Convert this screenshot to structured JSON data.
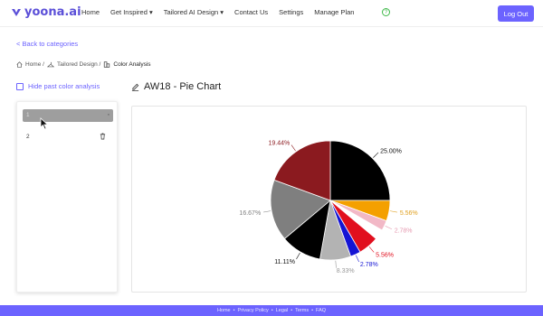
{
  "header": {
    "logo_text": "yoona.ai",
    "nav": [
      "Home",
      "Get Inspired ▾",
      "Tailored AI Design ▾",
      "Contact Us",
      "Settings",
      "Manage Plan"
    ],
    "logout_label": "Log Out",
    "accent_color": "#6c63ff"
  },
  "back_link": "< Back to categories",
  "breadcrumb": {
    "items": [
      "Home /",
      "Tailored Design /",
      "Color Analysis"
    ]
  },
  "hide_link": "Hide past color analysis",
  "page_title": "AW18 - Pie Chart",
  "sidebar": {
    "items": [
      {
        "label": "1",
        "selected": true
      },
      {
        "label": "2",
        "selected": false
      }
    ]
  },
  "chart_data": {
    "type": "pie",
    "slices": [
      {
        "label": "25.00%",
        "value": 25.0,
        "color": "#000000"
      },
      {
        "label": "5.56%",
        "value": 5.56,
        "color": "#f4a000"
      },
      {
        "label": "2.78%",
        "value": 2.78,
        "color": "#f2b8c6"
      },
      {
        "label": "",
        "value": 2.78,
        "color": "#ffffff"
      },
      {
        "label": "5.56%",
        "value": 5.56,
        "color": "#e10f1e"
      },
      {
        "label": "2.78%",
        "value": 2.78,
        "color": "#1414d4"
      },
      {
        "label": "8.33%",
        "value": 8.33,
        "color": "#b3b3b3"
      },
      {
        "label": "11.11%",
        "value": 11.11,
        "color": "#000000"
      },
      {
        "label": "16.67%",
        "value": 16.67,
        "color": "#7f7f7f"
      },
      {
        "label": "19.44%",
        "value": 19.44,
        "color": "#8b1a1f"
      }
    ]
  },
  "footer": {
    "links": [
      "Home",
      "•",
      "Privacy Policy",
      "•",
      "Legal",
      "•",
      "Terms",
      "•",
      "FAQ"
    ]
  }
}
